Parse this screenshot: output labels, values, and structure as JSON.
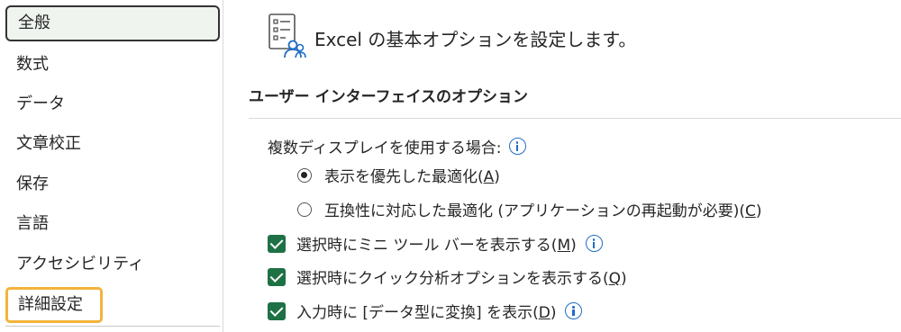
{
  "sidebar": {
    "items": [
      {
        "label": "全般"
      },
      {
        "label": "数式"
      },
      {
        "label": "データ"
      },
      {
        "label": "文章校正"
      },
      {
        "label": "保存"
      },
      {
        "label": "言語"
      },
      {
        "label": "アクセシビリティ"
      },
      {
        "label": "詳細設定"
      }
    ],
    "selected": "全般",
    "highlighted": "詳細設定",
    "highlight_color": "#f3b33a"
  },
  "header": {
    "title": "Excel の基本オプションを設定します。",
    "icon": "settings-person-icon"
  },
  "section": {
    "title": "ユーザー インターフェイスのオプション"
  },
  "multi_display": {
    "label": "複数ディスプレイを使用する場合:",
    "options": [
      {
        "text": "表示を優先した最適化(",
        "key": "A",
        "close": ")",
        "selected": true
      },
      {
        "text": "互換性に対応した最適化 (アプリケーションの再起動が必要)(",
        "key": "C",
        "close": ")",
        "selected": false
      }
    ]
  },
  "checkboxes": [
    {
      "text": "選択時にミニ ツール バーを表示する(",
      "key": "M",
      "close": ")",
      "checked": true,
      "info": true
    },
    {
      "text": "選択時にクイック分析オプションを表示する(",
      "key": "Q",
      "close": ")",
      "checked": true,
      "info": false
    },
    {
      "text": "入力時に [データ型に変換] を表示(",
      "key": "D",
      "close": ")",
      "checked": true,
      "info": true
    }
  ],
  "colors": {
    "checkbox": "#1e7145",
    "info": "#1f6fc4",
    "selected_bg": "#eff4ef"
  }
}
